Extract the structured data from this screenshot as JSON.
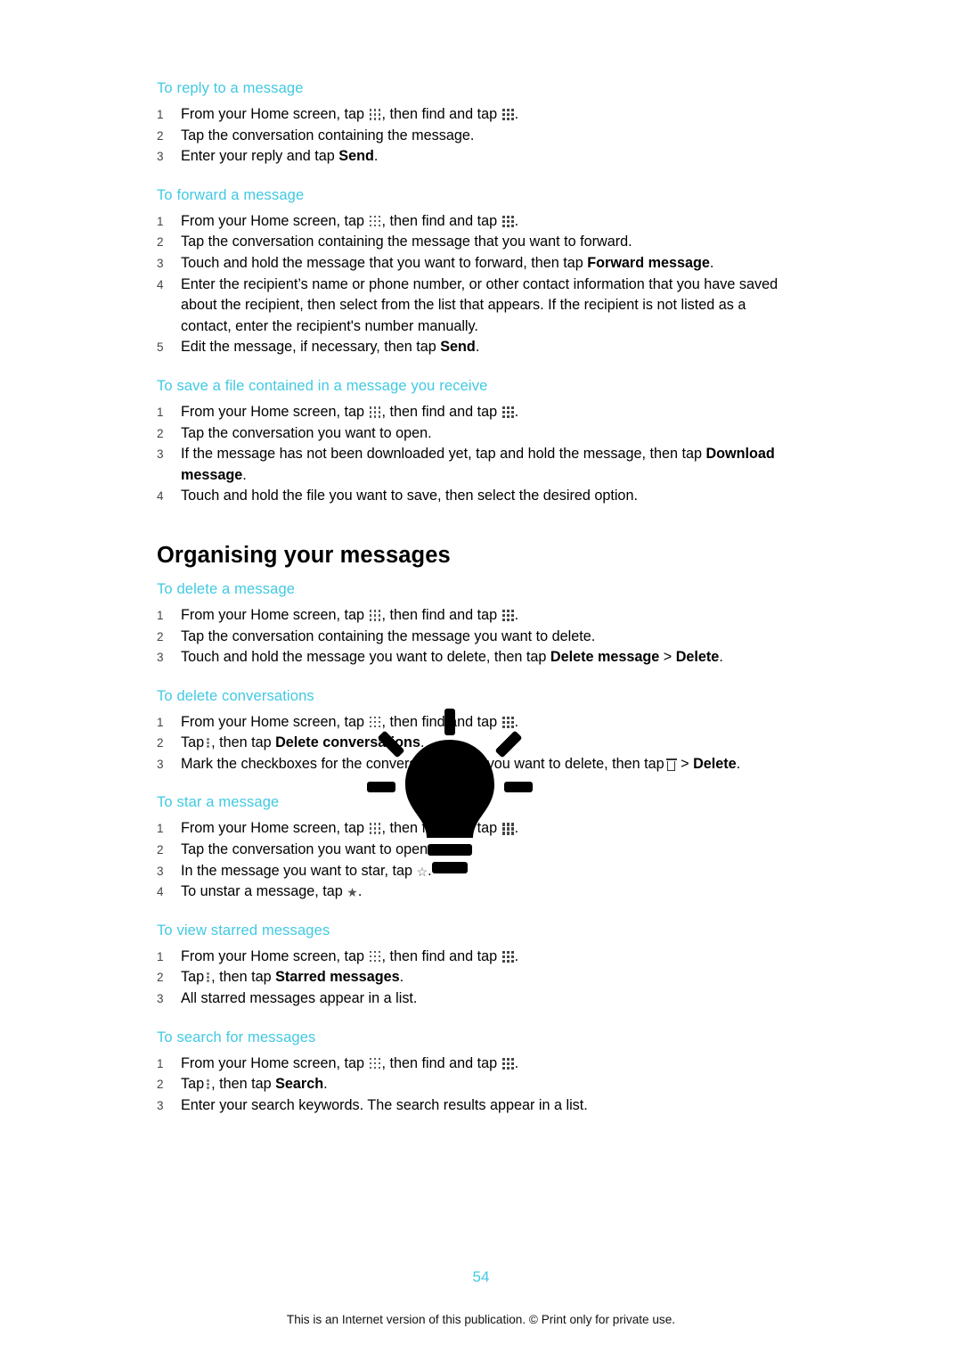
{
  "page": {
    "number": "54",
    "footer": "This is an Internet version of this publication. © Print only for private use."
  },
  "sections": [
    {
      "id": "reply",
      "heading": "To reply to a message",
      "steps": [
        "From your Home screen, tap ░, then find and tap ░.",
        "Tap the conversation containing the message.",
        "Enter your reply and tap Send."
      ]
    },
    {
      "id": "forward",
      "heading": "To forward a message",
      "steps": [
        "From your Home screen, tap ░, then find and tap ░.",
        "Tap the conversation containing the message that you want to forward.",
        "Touch and hold the message that you want to forward, then tap Forward message.",
        "Enter the recipient’s name or phone number, or other contact information that you have saved about the recipient, then select from the list that appears. If the recipient is not listed as a contact, enter the recipient's number manually.",
        "Edit the message, if necessary, then tap Send."
      ]
    },
    {
      "id": "save-file",
      "heading": "To save a file contained in a message you receive",
      "steps": [
        "From your Home screen, tap ░, then find and tap ░.",
        "Tap the conversation you want to open.",
        "If the message has not been downloaded yet, tap and hold the message, then tap Download message.",
        "Touch and hold the file you want to save, then select the desired option."
      ]
    }
  ],
  "organising": {
    "title": "Organising your messages",
    "sections": [
      {
        "id": "delete-message",
        "heading": "To delete a message",
        "steps": [
          "From your Home screen, tap ░, then find and tap ░.",
          "Tap the conversation containing the message you want to delete.",
          "Touch and hold the message you want to delete, then tap Delete message > Delete."
        ]
      },
      {
        "id": "delete-conversations",
        "heading": "To delete conversations",
        "steps": [
          "From your Home screen, tap ░, then find and tap ░.",
          "Tap ⋮, then tap Delete conversations.",
          "Mark the checkboxes for the conversations that you want to delete, then tap 🗑 > Delete."
        ]
      },
      {
        "id": "star-message",
        "heading": "To star a message",
        "steps": [
          "From your Home screen, tap ░, then find and tap ░.",
          "Tap the conversation you want to open.",
          "In the message you want to star, tap ☆.",
          "To unstar a message, tap ★."
        ]
      },
      {
        "id": "view-starred",
        "heading": "To view starred messages",
        "steps": [
          "From your Home screen, tap ░, then find and tap ░.",
          "Tap ⋮, then tap Starred messages.",
          "All starred messages appear in a list."
        ]
      },
      {
        "id": "search-messages",
        "heading": "To search for messages",
        "steps": [
          "From your Home screen, tap ░, then find and tap ░.",
          "Tap ⋮, then tap Search.",
          "Enter your search keywords. The search results appear in a list."
        ]
      }
    ]
  },
  "text": {
    "reply": {
      "s1a": "From your Home screen, tap",
      "s1b": ", then find and tap",
      "s1c": ".",
      "s2": "Tap the conversation containing the message.",
      "s3a": "Enter your reply and tap ",
      "s3b": "Send",
      "s3c": "."
    },
    "forward": {
      "s2": "Tap the conversation containing the message that you want to forward.",
      "s3a": "Touch and hold the message that you want to forward, then tap ",
      "s3b": "Forward message",
      "s3c": ".",
      "s4": "Enter the recipient’s name or phone number, or other contact information that you have saved about the recipient, then select from the list that appears. If the recipient is not listed as a contact, enter the recipient's number manually.",
      "s5a": "Edit the message, if necessary, then tap ",
      "s5b": "Send",
      "s5c": "."
    },
    "savefile": {
      "s2": "Tap the conversation you want to open.",
      "s3a": "If the message has not been downloaded yet, tap and hold the message, then tap ",
      "s3b": "Download message",
      "s3c": ".",
      "s4": "Touch and hold the file you want to save, then select the desired option."
    },
    "deletemsg": {
      "s2": "Tap the conversation containing the message you want to delete.",
      "s3a": "Touch and hold the message you want to delete, then tap ",
      "s3b": "Delete message",
      "s3c": " > ",
      "s3d": "Delete",
      "s3e": "."
    },
    "deleteconv": {
      "s2a": "Tap",
      "s2b": ", then tap ",
      "s2c": "Delete conversations",
      "s2d": ".",
      "s3a": "Mark the checkboxes for the conversations that you want to delete, then tap",
      "s3b": " > ",
      "s3c": "Delete",
      "s3d": "."
    },
    "star": {
      "s2": "Tap the conversation you want to open.",
      "s3": "In the message you want to star, tap",
      "s4": "To unstar a message, tap"
    },
    "viewstarred": {
      "s2a": "Tap",
      "s2b": ", then tap ",
      "s2c": "Starred messages",
      "s2d": ".",
      "s3": "All starred messages appear in a list."
    },
    "search": {
      "s2a": "Tap",
      "s2b": ", then tap ",
      "s2c": "Search",
      "s2d": ".",
      "s3": "Enter your search keywords. The search results appear in a list."
    }
  }
}
